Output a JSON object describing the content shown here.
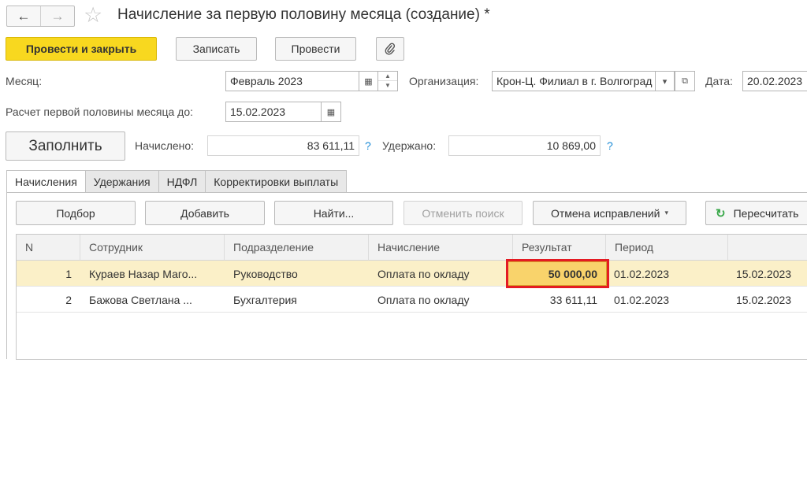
{
  "header": {
    "back_icon": "arrow-left-icon",
    "forward_icon": "arrow-right-icon",
    "star_icon": "star-outline-icon",
    "title": "Начисление за первую половину месяца (создание) *"
  },
  "toolbar": {
    "post_close_label": "Провести и закрыть",
    "save_label": "Записать",
    "post_label": "Провести",
    "attach_icon": "paperclip-icon"
  },
  "form": {
    "month_label": "Месяц:",
    "month_value": "Февраль 2023",
    "org_label": "Организация:",
    "org_value": "Крон-Ц. Филиал в г. Волгоград",
    "date_label": "Дата:",
    "date_value": "20.02.2023",
    "calc_label": "Расчет первой половины месяца до:",
    "calc_value": "15.02.2023",
    "fill_label": "Заполнить",
    "accrued_label": "Начислено:",
    "accrued_value": "83 611,11",
    "withheld_label": "Удержано:",
    "withheld_value": "10 869,00",
    "help_mark": "?"
  },
  "tabs": [
    {
      "label": "Начисления",
      "active": true
    },
    {
      "label": "Удержания",
      "active": false
    },
    {
      "label": "НДФЛ",
      "active": false
    },
    {
      "label": "Корректировки выплаты",
      "active": false
    }
  ],
  "table_toolbar": {
    "pick_label": "Подбор",
    "add_label": "Добавить",
    "find_label": "Найти...",
    "cancel_search_label": "Отменить поиск",
    "cancel_fix_label": "Отмена исправлений",
    "recalc_label": "Пересчитать",
    "refresh_icon": "refresh-icon"
  },
  "table": {
    "columns": [
      "N",
      "Сотрудник",
      "Подразделение",
      "Начисление",
      "Результат",
      "Период"
    ],
    "rows": [
      {
        "n": "1",
        "employee": "Кураев Назар Маго...",
        "dept": "Руководство",
        "accrual": "Оплата по окладу",
        "result": "50 000,00",
        "period_from": "01.02.2023",
        "period_to": "15.02.2023"
      },
      {
        "n": "2",
        "employee": "Бажова Светлана ...",
        "dept": "Бухгалтерия",
        "accrual": "Оплата по окладу",
        "result": "33 611,11",
        "period_from": "01.02.2023",
        "period_to": "15.02.2023"
      }
    ]
  },
  "colors": {
    "accent_yellow": "#f8d81f",
    "selected_row": "#fbf0c8",
    "highlight_cell": "#f9d36b",
    "annotation_red": "#e41b23",
    "help_blue": "#1a8ad5",
    "refresh_green": "#3aa84a"
  }
}
